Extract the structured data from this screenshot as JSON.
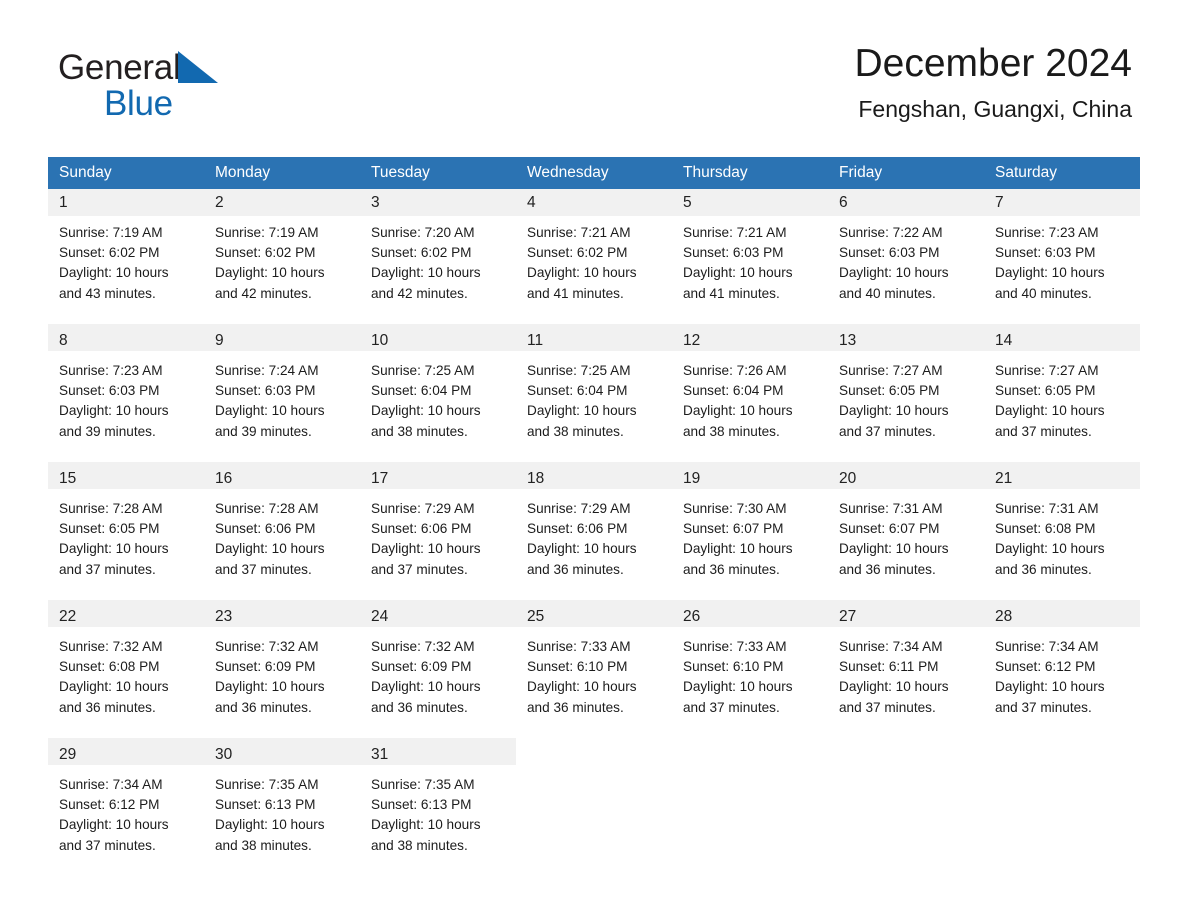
{
  "brand": {
    "name_part1": "General",
    "name_part2": "Blue",
    "triangle_color": "#1269b0"
  },
  "header": {
    "title": "December 2024",
    "subtitle": "Fengshan, Guangxi, China"
  },
  "theme": {
    "header_blue": "#2b73b3",
    "date_band_gray": "#f1f1f1",
    "text_dark": "#1c1c1c"
  },
  "calendar": {
    "weekday_headers": [
      "Sunday",
      "Monday",
      "Tuesday",
      "Wednesday",
      "Thursday",
      "Friday",
      "Saturday"
    ],
    "weeks": [
      {
        "filled_columns": 7,
        "days": [
          {
            "date": "1",
            "lines": [
              "Sunrise: 7:19 AM",
              "Sunset: 6:02 PM",
              "Daylight: 10 hours",
              "and 43 minutes."
            ]
          },
          {
            "date": "2",
            "lines": [
              "Sunrise: 7:19 AM",
              "Sunset: 6:02 PM",
              "Daylight: 10 hours",
              "and 42 minutes."
            ]
          },
          {
            "date": "3",
            "lines": [
              "Sunrise: 7:20 AM",
              "Sunset: 6:02 PM",
              "Daylight: 10 hours",
              "and 42 minutes."
            ]
          },
          {
            "date": "4",
            "lines": [
              "Sunrise: 7:21 AM",
              "Sunset: 6:02 PM",
              "Daylight: 10 hours",
              "and 41 minutes."
            ]
          },
          {
            "date": "5",
            "lines": [
              "Sunrise: 7:21 AM",
              "Sunset: 6:03 PM",
              "Daylight: 10 hours",
              "and 41 minutes."
            ]
          },
          {
            "date": "6",
            "lines": [
              "Sunrise: 7:22 AM",
              "Sunset: 6:03 PM",
              "Daylight: 10 hours",
              "and 40 minutes."
            ]
          },
          {
            "date": "7",
            "lines": [
              "Sunrise: 7:23 AM",
              "Sunset: 6:03 PM",
              "Daylight: 10 hours",
              "and 40 minutes."
            ]
          }
        ]
      },
      {
        "filled_columns": 7,
        "days": [
          {
            "date": "8",
            "lines": [
              "Sunrise: 7:23 AM",
              "Sunset: 6:03 PM",
              "Daylight: 10 hours",
              "and 39 minutes."
            ]
          },
          {
            "date": "9",
            "lines": [
              "Sunrise: 7:24 AM",
              "Sunset: 6:03 PM",
              "Daylight: 10 hours",
              "and 39 minutes."
            ]
          },
          {
            "date": "10",
            "lines": [
              "Sunrise: 7:25 AM",
              "Sunset: 6:04 PM",
              "Daylight: 10 hours",
              "and 38 minutes."
            ]
          },
          {
            "date": "11",
            "lines": [
              "Sunrise: 7:25 AM",
              "Sunset: 6:04 PM",
              "Daylight: 10 hours",
              "and 38 minutes."
            ]
          },
          {
            "date": "12",
            "lines": [
              "Sunrise: 7:26 AM",
              "Sunset: 6:04 PM",
              "Daylight: 10 hours",
              "and 38 minutes."
            ]
          },
          {
            "date": "13",
            "lines": [
              "Sunrise: 7:27 AM",
              "Sunset: 6:05 PM",
              "Daylight: 10 hours",
              "and 37 minutes."
            ]
          },
          {
            "date": "14",
            "lines": [
              "Sunrise: 7:27 AM",
              "Sunset: 6:05 PM",
              "Daylight: 10 hours",
              "and 37 minutes."
            ]
          }
        ]
      },
      {
        "filled_columns": 7,
        "days": [
          {
            "date": "15",
            "lines": [
              "Sunrise: 7:28 AM",
              "Sunset: 6:05 PM",
              "Daylight: 10 hours",
              "and 37 minutes."
            ]
          },
          {
            "date": "16",
            "lines": [
              "Sunrise: 7:28 AM",
              "Sunset: 6:06 PM",
              "Daylight: 10 hours",
              "and 37 minutes."
            ]
          },
          {
            "date": "17",
            "lines": [
              "Sunrise: 7:29 AM",
              "Sunset: 6:06 PM",
              "Daylight: 10 hours",
              "and 37 minutes."
            ]
          },
          {
            "date": "18",
            "lines": [
              "Sunrise: 7:29 AM",
              "Sunset: 6:06 PM",
              "Daylight: 10 hours",
              "and 36 minutes."
            ]
          },
          {
            "date": "19",
            "lines": [
              "Sunrise: 7:30 AM",
              "Sunset: 6:07 PM",
              "Daylight: 10 hours",
              "and 36 minutes."
            ]
          },
          {
            "date": "20",
            "lines": [
              "Sunrise: 7:31 AM",
              "Sunset: 6:07 PM",
              "Daylight: 10 hours",
              "and 36 minutes."
            ]
          },
          {
            "date": "21",
            "lines": [
              "Sunrise: 7:31 AM",
              "Sunset: 6:08 PM",
              "Daylight: 10 hours",
              "and 36 minutes."
            ]
          }
        ]
      },
      {
        "filled_columns": 7,
        "days": [
          {
            "date": "22",
            "lines": [
              "Sunrise: 7:32 AM",
              "Sunset: 6:08 PM",
              "Daylight: 10 hours",
              "and 36 minutes."
            ]
          },
          {
            "date": "23",
            "lines": [
              "Sunrise: 7:32 AM",
              "Sunset: 6:09 PM",
              "Daylight: 10 hours",
              "and 36 minutes."
            ]
          },
          {
            "date": "24",
            "lines": [
              "Sunrise: 7:32 AM",
              "Sunset: 6:09 PM",
              "Daylight: 10 hours",
              "and 36 minutes."
            ]
          },
          {
            "date": "25",
            "lines": [
              "Sunrise: 7:33 AM",
              "Sunset: 6:10 PM",
              "Daylight: 10 hours",
              "and 36 minutes."
            ]
          },
          {
            "date": "26",
            "lines": [
              "Sunrise: 7:33 AM",
              "Sunset: 6:10 PM",
              "Daylight: 10 hours",
              "and 37 minutes."
            ]
          },
          {
            "date": "27",
            "lines": [
              "Sunrise: 7:34 AM",
              "Sunset: 6:11 PM",
              "Daylight: 10 hours",
              "and 37 minutes."
            ]
          },
          {
            "date": "28",
            "lines": [
              "Sunrise: 7:34 AM",
              "Sunset: 6:12 PM",
              "Daylight: 10 hours",
              "and 37 minutes."
            ]
          }
        ]
      },
      {
        "filled_columns": 3,
        "days": [
          {
            "date": "29",
            "lines": [
              "Sunrise: 7:34 AM",
              "Sunset: 6:12 PM",
              "Daylight: 10 hours",
              "and 37 minutes."
            ]
          },
          {
            "date": "30",
            "lines": [
              "Sunrise: 7:35 AM",
              "Sunset: 6:13 PM",
              "Daylight: 10 hours",
              "and 38 minutes."
            ]
          },
          {
            "date": "31",
            "lines": [
              "Sunrise: 7:35 AM",
              "Sunset: 6:13 PM",
              "Daylight: 10 hours",
              "and 38 minutes."
            ]
          },
          {
            "date": "",
            "lines": []
          },
          {
            "date": "",
            "lines": []
          },
          {
            "date": "",
            "lines": []
          },
          {
            "date": "",
            "lines": []
          }
        ]
      }
    ]
  }
}
